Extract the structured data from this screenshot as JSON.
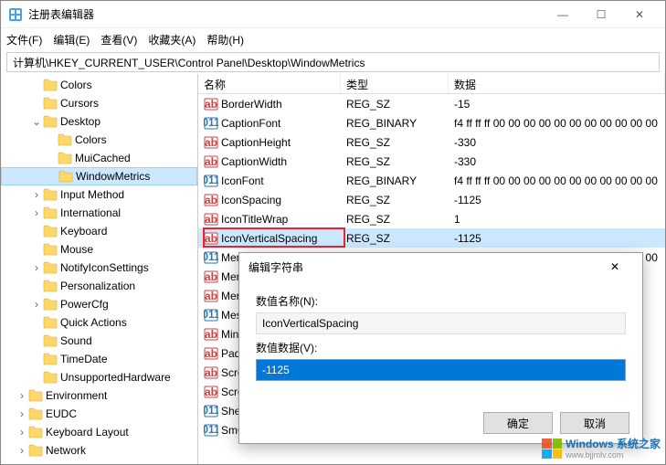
{
  "window": {
    "title": "注册表编辑器"
  },
  "menu": {
    "file": "文件(F)",
    "edit": "编辑(E)",
    "view": "查看(V)",
    "fav": "收藏夹(A)",
    "help": "帮助(H)"
  },
  "address": "计算机\\HKEY_CURRENT_USER\\Control Panel\\Desktop\\WindowMetrics",
  "tree": [
    {
      "d": 2,
      "tw": "",
      "l": "Colors"
    },
    {
      "d": 2,
      "tw": "",
      "l": "Cursors"
    },
    {
      "d": 2,
      "tw": "v",
      "l": "Desktop"
    },
    {
      "d": 3,
      "tw": "",
      "l": "Colors"
    },
    {
      "d": 3,
      "tw": "",
      "l": "MuiCached"
    },
    {
      "d": 3,
      "tw": "",
      "l": "WindowMetrics",
      "sel": true
    },
    {
      "d": 2,
      "tw": ">",
      "l": "Input Method"
    },
    {
      "d": 2,
      "tw": ">",
      "l": "International"
    },
    {
      "d": 2,
      "tw": "",
      "l": "Keyboard"
    },
    {
      "d": 2,
      "tw": "",
      "l": "Mouse"
    },
    {
      "d": 2,
      "tw": ">",
      "l": "NotifyIconSettings"
    },
    {
      "d": 2,
      "tw": "",
      "l": "Personalization"
    },
    {
      "d": 2,
      "tw": ">",
      "l": "PowerCfg"
    },
    {
      "d": 2,
      "tw": "",
      "l": "Quick Actions"
    },
    {
      "d": 2,
      "tw": "",
      "l": "Sound"
    },
    {
      "d": 2,
      "tw": "",
      "l": "TimeDate"
    },
    {
      "d": 2,
      "tw": "",
      "l": "UnsupportedHardware"
    },
    {
      "d": 1,
      "tw": ">",
      "l": "Environment"
    },
    {
      "d": 1,
      "tw": ">",
      "l": "EUDC"
    },
    {
      "d": 1,
      "tw": ">",
      "l": "Keyboard Layout"
    },
    {
      "d": 1,
      "tw": ">",
      "l": "Network"
    }
  ],
  "list_header": {
    "name": "名称",
    "type": "类型",
    "data": "数据"
  },
  "rows": [
    {
      "ic": "sz",
      "n": "BorderWidth",
      "t": "REG_SZ",
      "d": "-15"
    },
    {
      "ic": "bin",
      "n": "CaptionFont",
      "t": "REG_BINARY",
      "d": "f4 ff ff ff 00 00 00 00 00 00 00 00 00 00 00"
    },
    {
      "ic": "sz",
      "n": "CaptionHeight",
      "t": "REG_SZ",
      "d": "-330"
    },
    {
      "ic": "sz",
      "n": "CaptionWidth",
      "t": "REG_SZ",
      "d": "-330"
    },
    {
      "ic": "bin",
      "n": "IconFont",
      "t": "REG_BINARY",
      "d": "f4 ff ff ff 00 00 00 00 00 00 00 00 00 00 00"
    },
    {
      "ic": "sz",
      "n": "IconSpacing",
      "t": "REG_SZ",
      "d": "-1125"
    },
    {
      "ic": "sz",
      "n": "IconTitleWrap",
      "t": "REG_SZ",
      "d": "1"
    },
    {
      "ic": "sz",
      "n": "IconVerticalSpacing",
      "t": "REG_SZ",
      "d": "-1125",
      "sel": true
    },
    {
      "ic": "bin",
      "n": "MenuFont",
      "t": "REG_BINARY",
      "d": "f4 ff ff ff 00 00 00 00 00 00 00 00 00 00 00"
    },
    {
      "ic": "sz",
      "n": "Men"
    },
    {
      "ic": "sz",
      "n": "Mer"
    },
    {
      "ic": "bin",
      "n": "Mes"
    },
    {
      "ic": "sz",
      "n": "Min"
    },
    {
      "ic": "sz",
      "n": "Pad"
    },
    {
      "ic": "sz",
      "n": "Scro"
    },
    {
      "ic": "sz",
      "n": "Scro"
    },
    {
      "ic": "bin",
      "n": "Shel"
    },
    {
      "ic": "bin",
      "n": "SmC"
    }
  ],
  "dialog": {
    "title": "编辑字符串",
    "name_lbl": "数值名称(N):",
    "name_val": "IconVerticalSpacing",
    "data_lbl": "数值数据(V):",
    "data_val": "-1125",
    "ok": "确定",
    "cancel": "取消"
  },
  "watermark": {
    "brand": "Windows",
    "site": "系统之家",
    "url": "www.bjjmlv.com"
  },
  "colors": {
    "accent": "#0078d7",
    "highlight": "#e23",
    "sel_bg": "#cce8ff"
  }
}
